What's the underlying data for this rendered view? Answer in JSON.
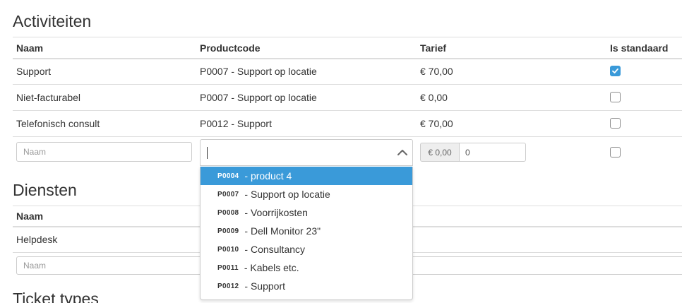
{
  "activiteiten": {
    "title": "Activiteiten",
    "headers": {
      "naam": "Naam",
      "productcode": "Productcode",
      "tarief": "Tarief",
      "is_standaard": "Is standaard"
    },
    "rows": [
      {
        "naam": "Support",
        "productcode": "P0007 - Support op locatie",
        "tarief": "€ 70,00",
        "is_standaard": true
      },
      {
        "naam": "Niet-facturabel",
        "productcode": "P0007 - Support op locatie",
        "tarief": "€ 0,00",
        "is_standaard": false
      },
      {
        "naam": "Telefonisch consult",
        "productcode": "P0012 - Support",
        "tarief": "€ 70,00",
        "is_standaard": false
      }
    ],
    "new_row": {
      "naam_placeholder": "Naam",
      "productcode_value": "",
      "tarief_prefix": "€ 0,00",
      "tarief_value": "0",
      "is_standaard": false
    }
  },
  "productcode_dropdown": {
    "highlighted_index": 0,
    "options": [
      {
        "code": "P0004",
        "label": "- product 4"
      },
      {
        "code": "P0007",
        "label": "- Support op locatie"
      },
      {
        "code": "P0008",
        "label": "- Voorrijkosten"
      },
      {
        "code": "P0009",
        "label": "- Dell Monitor 23\""
      },
      {
        "code": "P0010",
        "label": "- Consultancy"
      },
      {
        "code": "P0011",
        "label": "- Kabels etc."
      },
      {
        "code": "P0012",
        "label": "- Support"
      }
    ]
  },
  "diensten": {
    "title": "Diensten",
    "headers": {
      "naam": "Naam"
    },
    "rows": [
      {
        "naam": "Helpdesk"
      }
    ],
    "new_row": {
      "naam_placeholder": "Naam"
    }
  },
  "ticket_types": {
    "title": "Ticket types"
  },
  "colors": {
    "accent": "#3a9ad9",
    "border": "#dddddd",
    "text": "#333333"
  }
}
